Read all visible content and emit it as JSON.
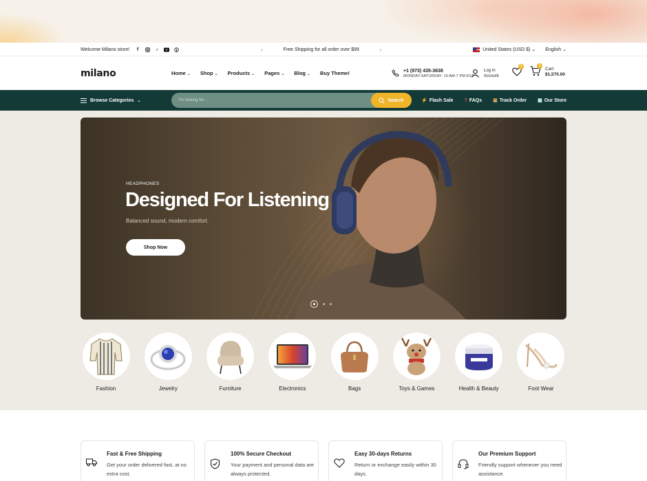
{
  "announcement": {
    "welcome": "Welcome Milano store!",
    "social_icons": [
      "facebook-icon",
      "instagram-icon",
      "tiktok-icon",
      "youtube-icon",
      "pinterest-icon"
    ],
    "shipping_text": "Free Shipping for all order over $99",
    "currency": "United States (USD $)",
    "language": "English"
  },
  "header": {
    "logo": "milano",
    "nav": [
      "Home",
      "Shop",
      "Products",
      "Pages",
      "Blog",
      "Buy Theme!"
    ],
    "phone": "+1 (973) 435-3638",
    "hours": "MONDAY-SATURDAY: 10 AM-7 PM EST",
    "account_line1": "Log In",
    "account_line2": "Account",
    "wishlist_count": "0",
    "cart_count": "3",
    "cart_label": "Cart",
    "cart_total": "$1,570.00"
  },
  "toolbar": {
    "browse": "Browse Categories",
    "search_placeholder": "I'm looking for...",
    "search_button": "Search",
    "links": [
      "Flash Sale",
      "FAQs",
      "Track Order",
      "Our Store"
    ]
  },
  "hero": {
    "eyebrow": "HEADPHONES",
    "title": "Designed For Listening",
    "subtitle": "Balanced sound, modern comfort.",
    "cta": "Shop Now",
    "slides": 3,
    "active_slide": 1
  },
  "categories": [
    "Fashion",
    "Jewelry",
    "Furniture",
    "Electronics",
    "Bags",
    "Toys & Games",
    "Health & Beauty",
    "Foot Wear"
  ],
  "features": [
    {
      "title": "Fast & Free Shipping",
      "desc": "Get your order delivered fast, at no extra cost.",
      "icon": "truck-icon"
    },
    {
      "title": "100% Secure Checkout",
      "desc": "Your payment and personal data are always protected.",
      "icon": "shield-check-icon"
    },
    {
      "title": "Easy 30-days Returns",
      "desc": "Return or exchange easily within 30 days.",
      "icon": "heart-icon"
    },
    {
      "title": "Our Premium Support",
      "desc": "Friendly support whenever you need assistance.",
      "icon": "headset-icon"
    }
  ],
  "colors": {
    "brand_dark": "#133a36",
    "accent": "#f0b429"
  }
}
